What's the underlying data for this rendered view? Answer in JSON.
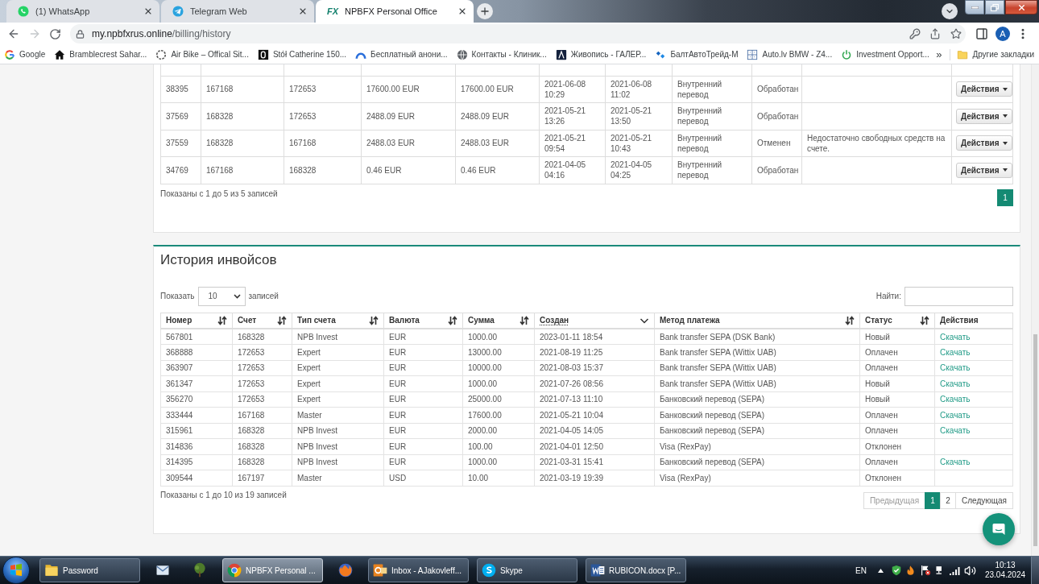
{
  "browser": {
    "tabs": [
      {
        "title": "(1) WhatsApp",
        "kind": "whatsapp",
        "selected": false
      },
      {
        "title": "Telegram Web",
        "kind": "telegram",
        "selected": false
      },
      {
        "title": "NPBFX Personal Office",
        "kind": "fx",
        "logo": "FX",
        "selected": true
      }
    ],
    "address": {
      "host": "my.npbfxrus.online",
      "path": "/billing/history"
    },
    "profile_initial": "A",
    "bookmarks": [
      {
        "label": "Google",
        "kind": "google"
      },
      {
        "label": "Bramblecrest Sahar...",
        "kind": "home"
      },
      {
        "label": "Air Bike – Offical Sit...",
        "kind": "bike"
      },
      {
        "label": "Stół Catherine 150...",
        "kind": "square"
      },
      {
        "label": "Бесплатный анони...",
        "kind": "arc"
      },
      {
        "label": "Контакты - Клиник...",
        "kind": "globe"
      },
      {
        "label": "Живопись - ГАЛЕР...",
        "kind": "peak"
      },
      {
        "label": "БалтАвтоТрейд-М",
        "kind": "diamonds"
      },
      {
        "label": "Auto.lv BMW - Z4...",
        "kind": "grid"
      },
      {
        "label": "Investment Opport...",
        "kind": "power"
      }
    ],
    "more_bookmarks": "»",
    "other_bookmarks": "Другие закладки"
  },
  "transfers": {
    "rows": [
      {
        "column_1": "38395",
        "column_2": "167168",
        "column_3": "172653",
        "column_4": "17600.00 EUR",
        "column_5": "17600.00 EUR",
        "column_6": "2021-06-08 10:29",
        "column_7": "2021-06-08 11:02",
        "column_8": "Внутренний перевод",
        "column_9": "Обработан",
        "button": "Действия"
      },
      {
        "column_1": "37569",
        "column_2": "168328",
        "column_3": "172653",
        "column_4": "2488.09 EUR",
        "column_5": "2488.09 EUR",
        "column_6": "2021-05-21 13:26",
        "column_7": "2021-05-21 13:50",
        "column_8": "Внутренний перевод",
        "column_9": "Обработан",
        "button": "Действия"
      },
      {
        "column_1": "37559",
        "column_2": "168328",
        "column_3": "167168",
        "column_4": "2488.03 EUR",
        "column_5": "2488.03 EUR",
        "column_6": "2021-05-21 09:54",
        "column_7": "2021-05-21 10:43",
        "column_8": "Внутренний перевод",
        "column_9": "Отменен",
        "column_10": "Недостаточно свободных средств на счете.",
        "button": "Действия"
      },
      {
        "column_1": "34769",
        "column_2": "167168",
        "column_3": "168328",
        "column_4": "0.46 EUR",
        "column_5": "0.46 EUR",
        "column_6": "2021-04-05 04:16",
        "column_7": "2021-04-05 04:25",
        "column_8": "Внутренний перевод",
        "column_9": "Обработан",
        "button": "Действия"
      }
    ],
    "info": "Показаны с 1 до 5 из 5 записей",
    "pages": [
      {
        "label": "1",
        "selected": true
      }
    ]
  },
  "invoices": {
    "title": "История инвойсов",
    "length_prefix": "Показать",
    "length_value": "10",
    "length_suffix": "записей",
    "search_label": "Найти:",
    "columns": [
      {
        "label": "Номер",
        "sortable": true,
        "sorted": false
      },
      {
        "label": "Счет",
        "sortable": true,
        "sorted": false
      },
      {
        "label": "Тип счета",
        "sortable": true,
        "sorted": false
      },
      {
        "label": "Валюта",
        "sortable": true,
        "sorted": false
      },
      {
        "label": "Сумма",
        "sortable": true,
        "sorted": false
      },
      {
        "label": "Создан",
        "sortable": true,
        "sorted": true
      },
      {
        "label": "Метод платежа",
        "sortable": true,
        "sorted": false
      },
      {
        "label": "Статус",
        "sortable": true,
        "sorted": false
      },
      {
        "label": "Действия",
        "sortable": false,
        "sorted": false
      }
    ],
    "rows": [
      {
        "cells": [
          "567801",
          "168328",
          "NPB Invest",
          "EUR",
          "1000.00",
          "2023-01-11 18:54",
          "Bank transfer SEPA (DSK Bank)",
          "Новый"
        ],
        "download": "Скачать"
      },
      {
        "cells": [
          "368888",
          "172653",
          "Expert",
          "EUR",
          "13000.00",
          "2021-08-19 11:25",
          "Bank transfer SEPA (Wittix UAB)",
          "Оплачен"
        ],
        "download": "Скачать"
      },
      {
        "cells": [
          "363907",
          "172653",
          "Expert",
          "EUR",
          "10000.00",
          "2021-08-03 15:37",
          "Bank transfer SEPA (Wittix UAB)",
          "Оплачен"
        ],
        "download": "Скачать"
      },
      {
        "cells": [
          "361347",
          "172653",
          "Expert",
          "EUR",
          "1000.00",
          "2021-07-26 08:56",
          "Bank transfer SEPA (Wittix UAB)",
          "Новый"
        ],
        "download": "Скачать"
      },
      {
        "cells": [
          "356270",
          "172653",
          "Expert",
          "EUR",
          "25000.00",
          "2021-07-13 11:10",
          "Банковский перевод (SEPA)",
          "Новый"
        ],
        "download": "Скачать"
      },
      {
        "cells": [
          "333444",
          "167168",
          "Master",
          "EUR",
          "17600.00",
          "2021-05-21 10:04",
          "Банковский перевод (SEPA)",
          "Оплачен"
        ],
        "download": "Скачать"
      },
      {
        "cells": [
          "315961",
          "168328",
          "NPB Invest",
          "EUR",
          "2000.00",
          "2021-04-05 14:05",
          "Банковский перевод (SEPA)",
          "Оплачен"
        ],
        "download": "Скачать"
      },
      {
        "cells": [
          "314836",
          "168328",
          "NPB Invest",
          "EUR",
          "100.00",
          "2021-04-01 12:50",
          "Visa (RexPay)",
          "Отклонен"
        ]
      },
      {
        "cells": [
          "314395",
          "168328",
          "NPB Invest",
          "EUR",
          "1000.00",
          "2021-03-31 15:41",
          "Банковский перевод (SEPA)",
          "Оплачен"
        ],
        "download": "Скачать"
      },
      {
        "cells": [
          "309544",
          "167197",
          "Master",
          "USD",
          "10.00",
          "2021-03-19 19:39",
          "Visa (RexPay)",
          "Отклонен"
        ]
      }
    ],
    "info": "Показаны с 1 до 10 из 19 записей",
    "pagination": [
      {
        "label": "Предыдущая",
        "kind": "prev",
        "selected": false,
        "disabled": true
      },
      {
        "label": "1",
        "kind": "page",
        "selected": true,
        "disabled": false
      },
      {
        "label": "2",
        "kind": "page",
        "selected": false,
        "disabled": false
      },
      {
        "label": "Следующая",
        "kind": "next",
        "selected": false,
        "disabled": false
      }
    ]
  },
  "taskbar": {
    "items": [
      {
        "kind": "folder",
        "label": "Password",
        "selected": false
      },
      {
        "kind": "mail",
        "selected": false
      },
      {
        "kind": "tree",
        "selected": false
      },
      {
        "kind": "chrome",
        "label": "NPBFX Personal ...",
        "selected": true
      },
      {
        "kind": "firefox",
        "selected": false
      },
      {
        "kind": "outlook",
        "label": "Inbox - AJakovleff...",
        "selected": false
      },
      {
        "kind": "skype",
        "label": "Skype",
        "selected": false
      },
      {
        "kind": "word",
        "label": "RUBICON.docx [P...",
        "selected": false
      }
    ],
    "language": "EN",
    "time": "10:13",
    "date": "23.04.2024"
  }
}
